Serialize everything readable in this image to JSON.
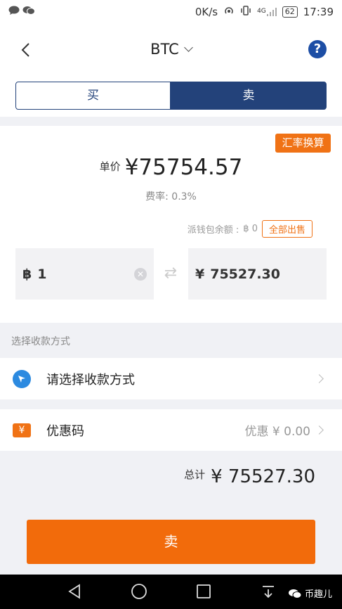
{
  "status_bar": {
    "speed": "0K/s",
    "network": "4G",
    "battery": "62",
    "time": "17:39"
  },
  "header": {
    "title": "BTC"
  },
  "tabs": {
    "buy": "买",
    "sell": "卖"
  },
  "rate_button": "汇率换算",
  "price": {
    "label": "单价",
    "value": "¥75754.57"
  },
  "fee": "费率: 0.3%",
  "wallet": {
    "label": "派钱包余额 :",
    "balance": "฿ 0",
    "sell_all": "全部出售"
  },
  "inputs": {
    "btc_symbol": "฿",
    "btc_amount": "1",
    "cny_symbol": "¥",
    "cny_amount": "75527.30"
  },
  "section_label": "选择收款方式",
  "payment": {
    "label": "请选择收款方式"
  },
  "coupon": {
    "label": "优惠码",
    "value": "优惠 ¥ 0.00"
  },
  "total": {
    "label": "总计",
    "value": "¥ 75527.30"
  },
  "submit_button": "卖",
  "watermark": "币趣儿",
  "colors": {
    "accent_orange": "#f26b0b",
    "navy": "#23427a",
    "help_blue": "#1d4ea5"
  }
}
